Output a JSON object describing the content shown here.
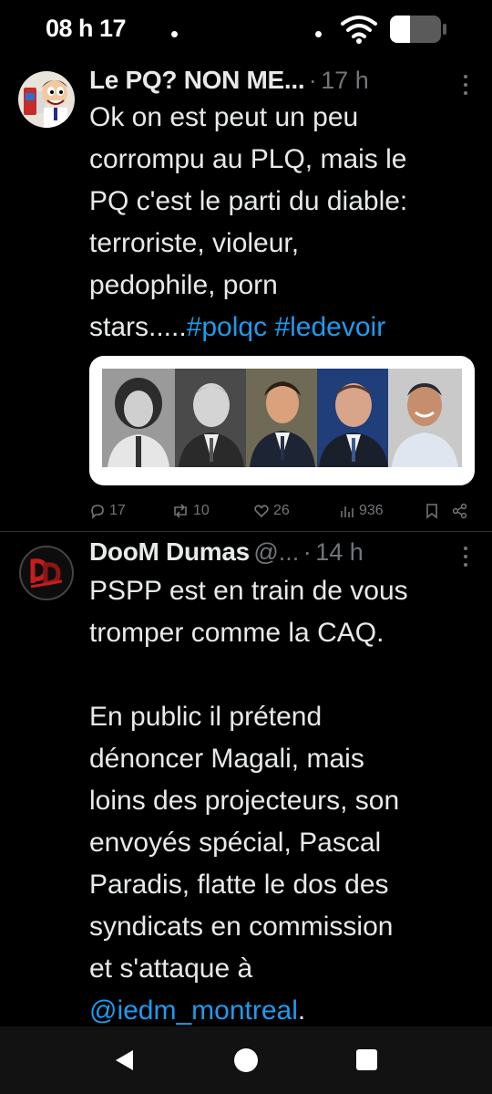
{
  "status_bar": {
    "time": "08 h 17",
    "icons": [
      "notification-dot",
      "wifi-icon",
      "battery-icon"
    ],
    "battery_level": 0.4
  },
  "tweets": [
    {
      "display_name": "Le PQ? NON ME...",
      "separator": "·",
      "time_ago": "17 h",
      "text_lines": [
        "Ok on est peut un peu",
        "corrompu au PLQ, mais le",
        "PQ c'est le parti du diable:",
        "terroriste, violeur,",
        "pedophile, porn"
      ],
      "last_line_prefix": "stars.....",
      "hashtags": [
        "#polqc",
        "#ledevoir"
      ],
      "media": {
        "type": "image",
        "photo_count": 5
      },
      "stats": {
        "replies": "17",
        "reposts": "10",
        "likes": "26",
        "views": "936"
      }
    },
    {
      "display_name": "DooM Dumas",
      "handle": "@...",
      "separator": "·",
      "time_ago": "14 h",
      "avatar_text": "Est. 1982",
      "text_lines": [
        "PSPP est en train de vous",
        "tromper comme la CAQ.",
        "",
        "En public il prétend",
        "dénoncer Magali, mais",
        "loins des projecteurs, son",
        "envoyés spécial, Pascal",
        "Paradis, flatte le dos des",
        "syndicats en commission",
        "et s'attaque à"
      ],
      "mention": "@iedm_montreal",
      "mention_suffix": "."
    }
  ],
  "colors": {
    "background": "#000000",
    "text": "#e7e9ea",
    "muted": "#71767b",
    "link": "#1d9bf0",
    "divider": "#2f3336",
    "nav_bar": "#121212"
  },
  "nav_bar": {
    "icons": [
      "back-icon",
      "home-icon",
      "recents-icon"
    ]
  }
}
